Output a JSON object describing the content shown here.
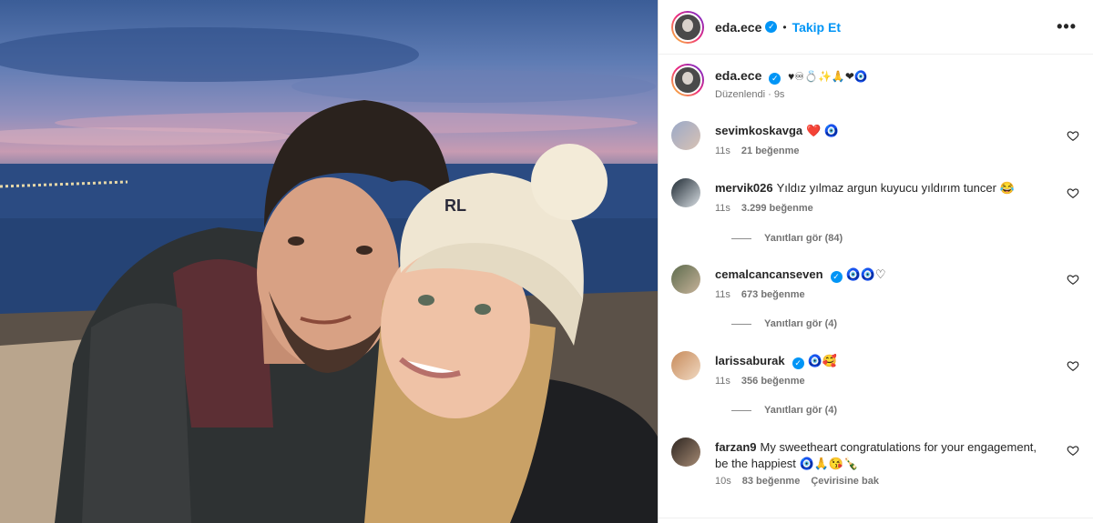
{
  "post": {
    "username": "eda.ece",
    "follow_label": "Takip Et",
    "more_label": "•••",
    "caption_emojis": "♥♾💍✨🙏❤🧿",
    "caption_meta": "Düzenlendi · 9s"
  },
  "comments": [
    {
      "username": "sevimkoskavga",
      "text": "❤️ 🧿",
      "time": "11s",
      "likes": "21 beğenme",
      "replies": "",
      "verified": false
    },
    {
      "username": "mervik026",
      "text": "Yıldız yılmaz argun kuyucu yıldırım tuncer 😂",
      "time": "11s",
      "likes": "3.299 beğenme",
      "replies": "Yanıtları gör (84)",
      "verified": false
    },
    {
      "username": "cemalcancanseven",
      "text": "🧿🧿♡",
      "time": "11s",
      "likes": "673 beğenme",
      "replies": "Yanıtları gör (4)",
      "verified": true
    },
    {
      "username": "larissaburak",
      "text": "🧿🥰",
      "time": "11s",
      "likes": "356 beğenme",
      "replies": "Yanıtları gör (4)",
      "verified": true
    },
    {
      "username": "farzan9",
      "text": "My sweetheart congratulations for your engagement, be the happiest 🧿🙏😘🍾",
      "time": "10s",
      "likes": "83 beğenme",
      "translate": "Çevirisine bak",
      "replies": "",
      "verified": false
    }
  ]
}
